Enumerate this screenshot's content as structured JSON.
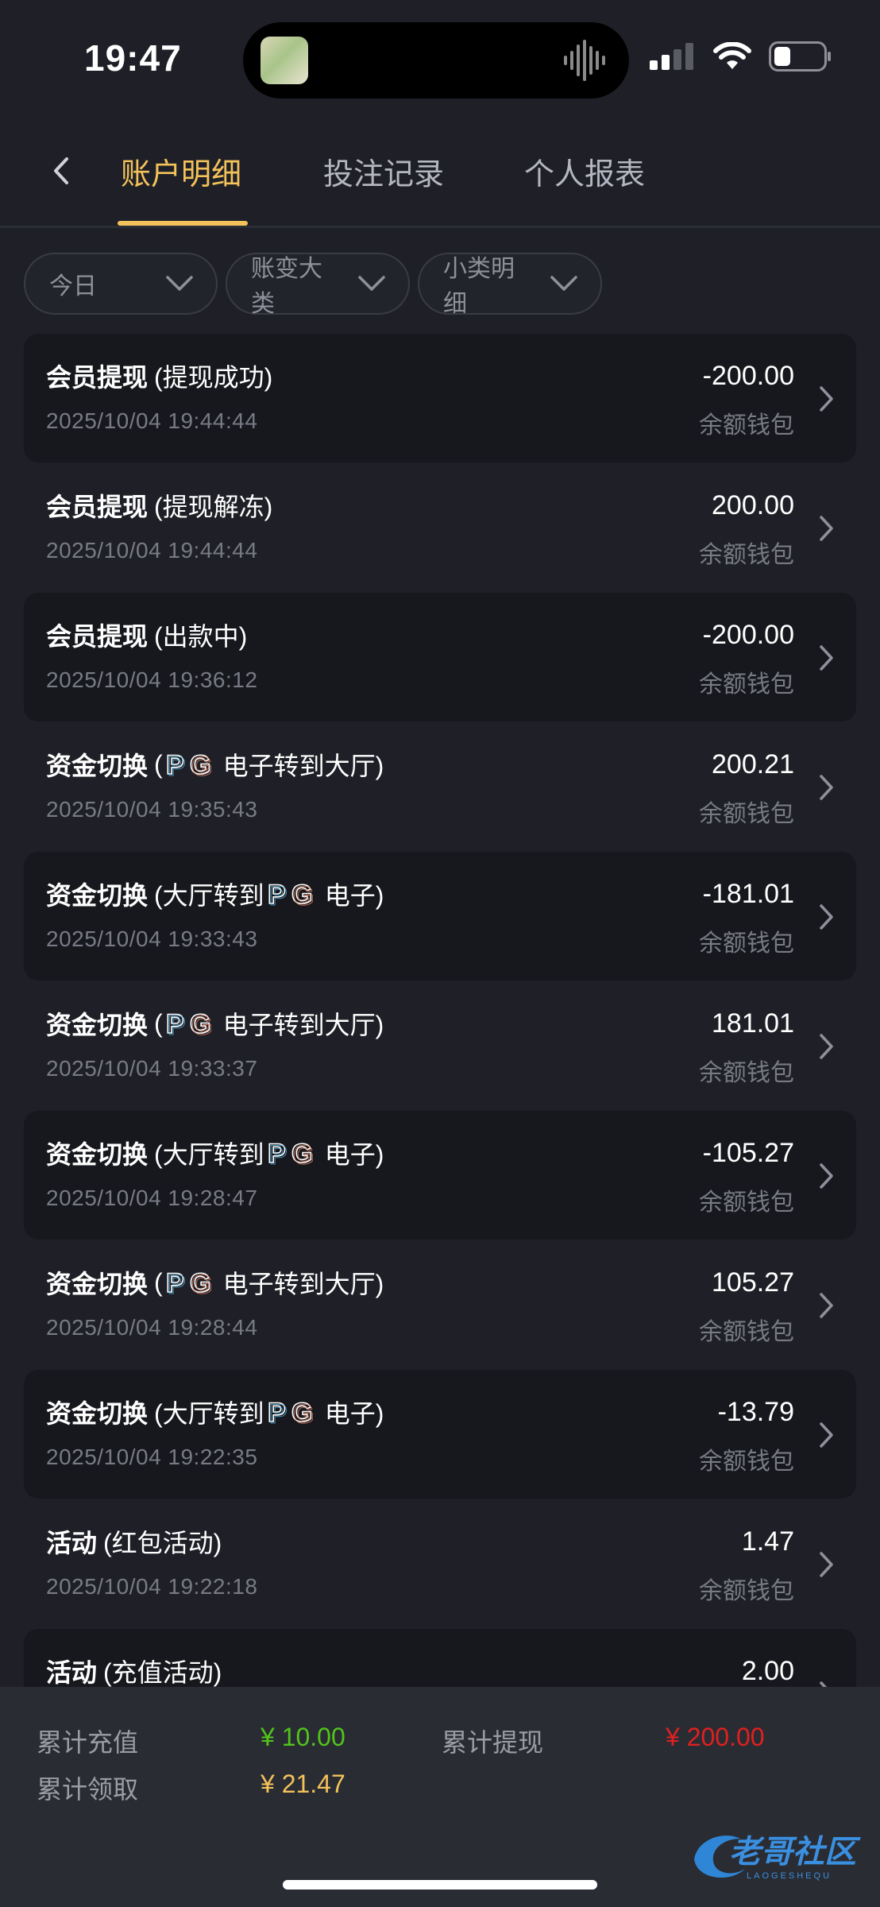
{
  "status_bar": {
    "time": "19:47"
  },
  "nav": {
    "tabs": [
      {
        "label": "账户明细",
        "active": true
      },
      {
        "label": "投注记录",
        "active": false
      },
      {
        "label": "个人报表",
        "active": false
      }
    ]
  },
  "filters": [
    {
      "label": "今日"
    },
    {
      "label": "账变大类"
    },
    {
      "label": "小类明细"
    }
  ],
  "records": [
    {
      "type": "会员提现",
      "detail_parts": [
        "(提现成功)"
      ],
      "time": "2025/10/04 19:44:44",
      "amount": "-200.00",
      "wallet": "余额钱包"
    },
    {
      "type": "会员提现",
      "detail_parts": [
        "(提现解冻)"
      ],
      "time": "2025/10/04 19:44:44",
      "amount": "200.00",
      "wallet": "余额钱包"
    },
    {
      "type": "会员提现",
      "detail_parts": [
        "(出款中)"
      ],
      "time": "2025/10/04 19:36:12",
      "amount": "-200.00",
      "wallet": "余额钱包"
    },
    {
      "type": "资金切换",
      "detail_parts": [
        "(",
        "PG",
        "电子转到大厅)"
      ],
      "time": "2025/10/04 19:35:43",
      "amount": "200.21",
      "wallet": "余额钱包"
    },
    {
      "type": "资金切换",
      "detail_parts": [
        "(大厅转到",
        "PG",
        "电子)"
      ],
      "time": "2025/10/04 19:33:43",
      "amount": "-181.01",
      "wallet": "余额钱包"
    },
    {
      "type": "资金切换",
      "detail_parts": [
        "(",
        "PG",
        "电子转到大厅)"
      ],
      "time": "2025/10/04 19:33:37",
      "amount": "181.01",
      "wallet": "余额钱包"
    },
    {
      "type": "资金切换",
      "detail_parts": [
        "(大厅转到",
        "PG",
        "电子)"
      ],
      "time": "2025/10/04 19:28:47",
      "amount": "-105.27",
      "wallet": "余额钱包"
    },
    {
      "type": "资金切换",
      "detail_parts": [
        "(",
        "PG",
        "电子转到大厅)"
      ],
      "time": "2025/10/04 19:28:44",
      "amount": "105.27",
      "wallet": "余额钱包"
    },
    {
      "type": "资金切换",
      "detail_parts": [
        "(大厅转到",
        "PG",
        "电子)"
      ],
      "time": "2025/10/04 19:22:35",
      "amount": "-13.79",
      "wallet": "余额钱包"
    },
    {
      "type": "活动",
      "detail_parts": [
        "(红包活动)"
      ],
      "time": "2025/10/04 19:22:18",
      "amount": "1.47",
      "wallet": "余额钱包"
    },
    {
      "type": "活动",
      "detail_parts": [
        "(充值活动)"
      ],
      "time": "",
      "amount": "2.00",
      "wallet": ""
    }
  ],
  "summary": {
    "total_recharge_label": "累计充值",
    "total_recharge_value": "¥ 10.00",
    "total_withdraw_label": "累计提现",
    "total_withdraw_value": "¥ 200.00",
    "total_claim_label": "累计领取",
    "total_claim_value": "¥ 21.47"
  },
  "watermark": {
    "text": "老哥社区",
    "subtext": "LAOGESHEQU"
  },
  "colors": {
    "accent": "#f3c25a",
    "recharge": "#52c41a",
    "withdraw": "#e02020",
    "claim": "#f3c25a"
  },
  "icons": [
    "back-chevron-icon",
    "chevron-down-icon",
    "chevron-right-icon",
    "pg-logo-icon",
    "signal-icon",
    "wifi-icon",
    "battery-icon",
    "audio-wave-icon"
  ]
}
